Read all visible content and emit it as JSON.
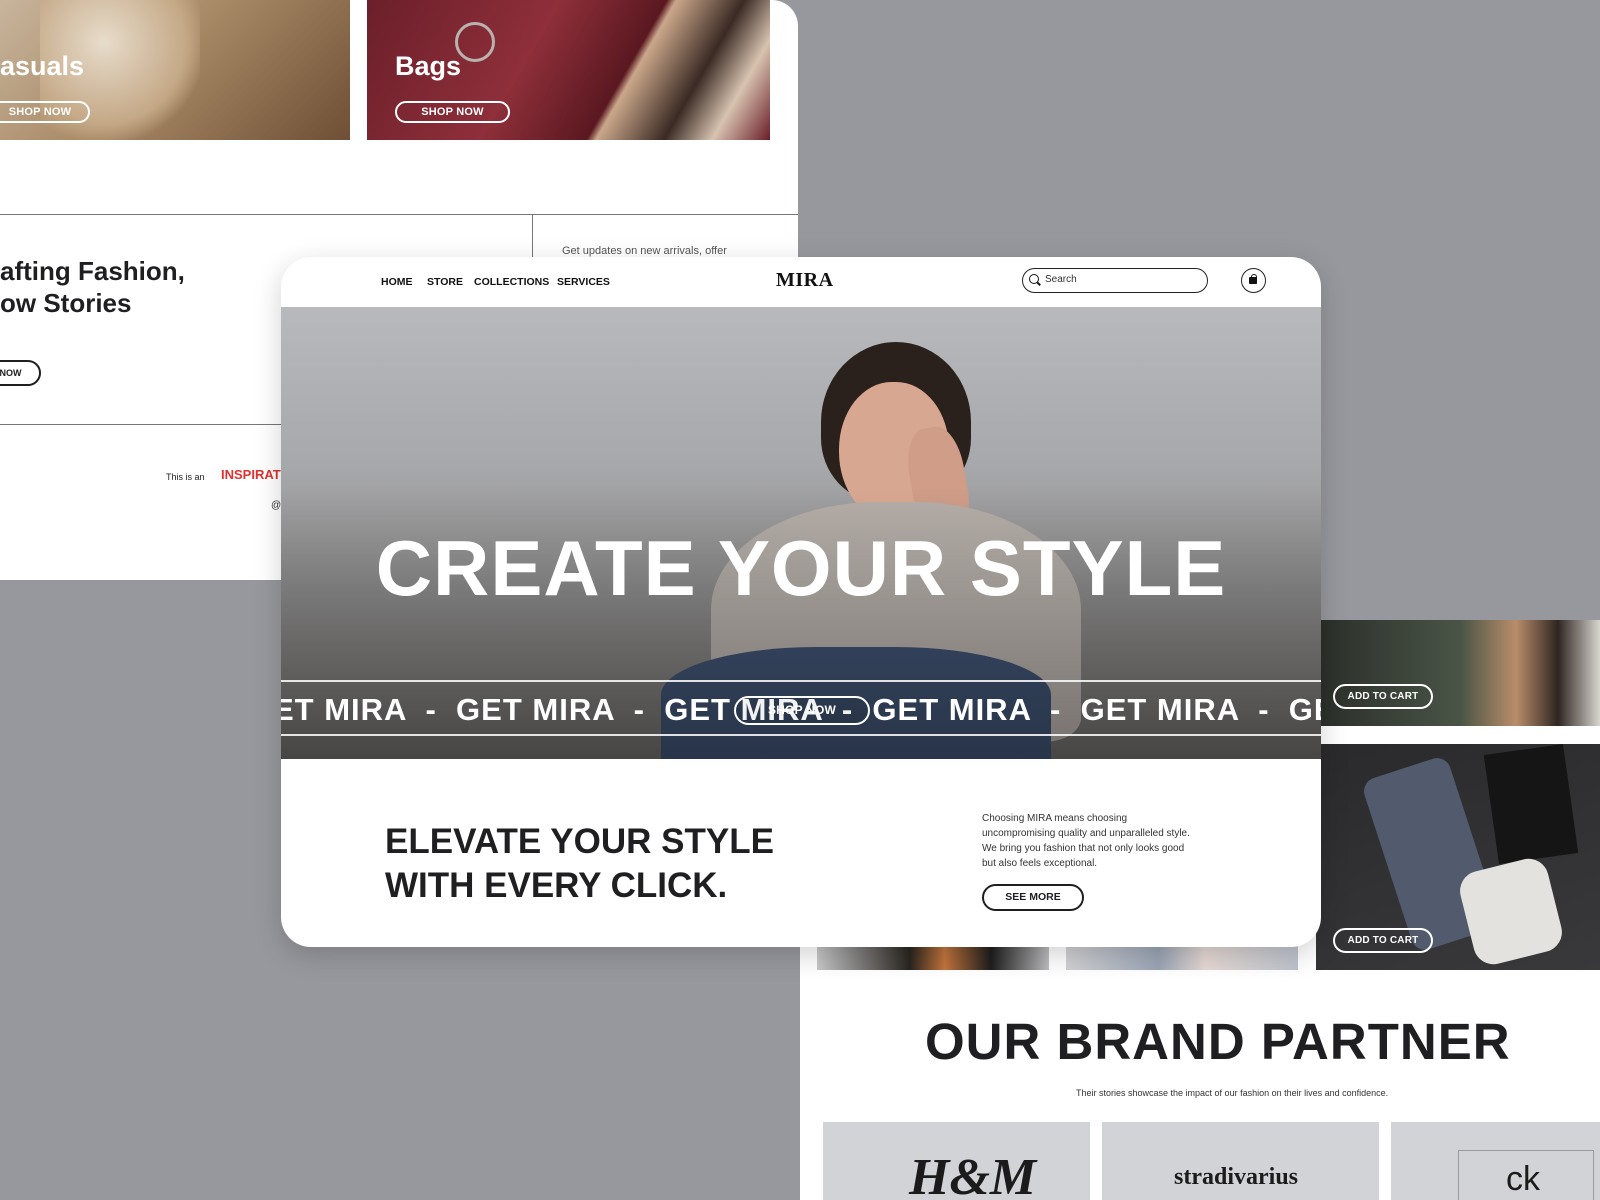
{
  "colors": {
    "background": "#97989d",
    "accent_red": "#e0312f",
    "dark_text": "#1f1f22"
  },
  "back_left": {
    "categories": [
      {
        "title": "asuals",
        "button": "SHOP NOW"
      },
      {
        "title": "Bags",
        "button": "SHOP NOW"
      }
    ],
    "story_heading_line1": "afting Fashion,",
    "story_heading_line2": "ow Stories",
    "story_button": "NOW",
    "newsletter_text": "Get updates on new arrivals, offer",
    "footer_prefix": "This is an",
    "footer_highlight": "INSPIRAT",
    "footer_symbol": "@"
  },
  "back_right": {
    "add_to_cart": "ADD TO CART",
    "brand_title": "OUR BRAND PARTNER",
    "brand_subtitle": "Their stories showcase the impact of our fashion on their lives and confidence.",
    "brands": [
      "H&M",
      "stradivarius",
      "ck"
    ]
  },
  "front": {
    "nav": [
      "HOME",
      "STORE",
      "COLLECTIONS",
      "SERVICES"
    ],
    "logo": "MIRA",
    "search_placeholder": "Search",
    "hero_title": "CREATE YOUR STYLE",
    "marquee": "ET MIRA  -  GET MIRA  -  GET MIRA  -  GET MIRA  -  GET MIRA  -  GE",
    "hero_button": "SHOP NOW",
    "tagline_line1": "ELEVATE YOUR STYLE",
    "tagline_line2": "WITH EVERY CLICK.",
    "description": "Choosing MIRA means choosing uncompromising quality and unparalleled style. We bring you fashion that not only looks good but also feels exceptional.",
    "see_more": "SEE MORE"
  }
}
